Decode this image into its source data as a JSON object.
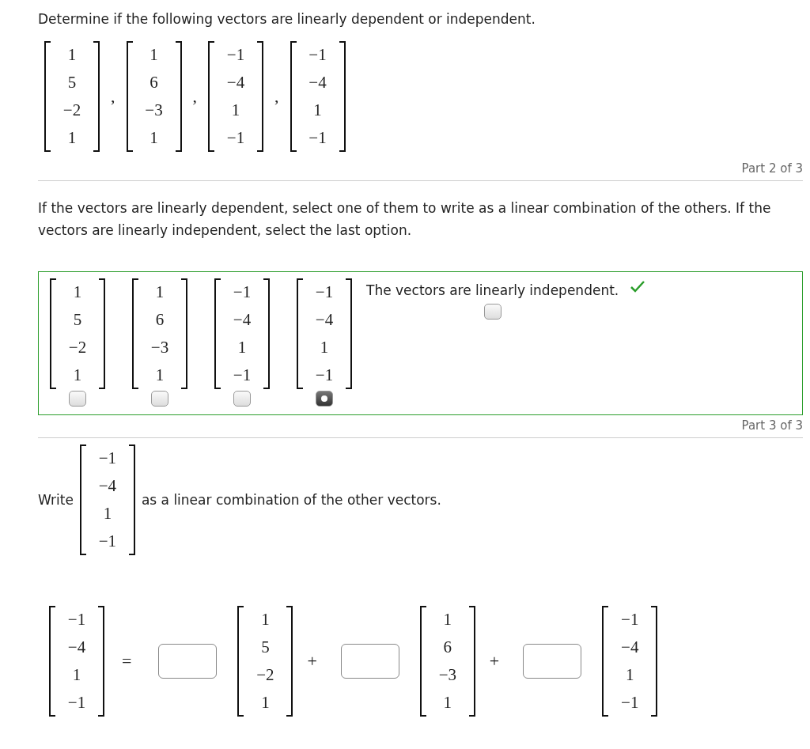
{
  "question": "Determine if the following vectors are linearly dependent or independent.",
  "vectors": [
    {
      "entries": [
        "1",
        "5",
        "−2",
        "1"
      ],
      "separator": ","
    },
    {
      "entries": [
        "1",
        "6",
        "−3",
        "1"
      ],
      "separator": ","
    },
    {
      "entries": [
        "−1",
        "−4",
        "1",
        "−1"
      ],
      "separator": ","
    },
    {
      "entries": [
        "−1",
        "−4",
        "1",
        "−1"
      ]
    }
  ],
  "part2": {
    "label": "Part 2 of 3",
    "prompt": "If the vectors are linearly dependent, select one of them to write as a linear combination of the others. If the vectors are linearly independent, select the last option.",
    "correct": true,
    "options": [
      {
        "kind": "vector",
        "entries": [
          "1",
          "5",
          "−2",
          "1"
        ],
        "selected": false
      },
      {
        "kind": "vector",
        "entries": [
          "1",
          "6",
          "−3",
          "1"
        ],
        "selected": false
      },
      {
        "kind": "vector",
        "entries": [
          "−1",
          "−4",
          "1",
          "−1"
        ],
        "selected": false
      },
      {
        "kind": "vector",
        "entries": [
          "−1",
          "−4",
          "1",
          "−1"
        ],
        "selected": true
      },
      {
        "kind": "text",
        "text": "The vectors are linearly independent.",
        "selected": false
      }
    ]
  },
  "part3": {
    "label": "Part 3 of 3",
    "write": "Write",
    "vector": [
      "−1",
      "−4",
      "1",
      "−1"
    ],
    "rest": "as a linear combination of the other vectors.",
    "equation": {
      "lhs": [
        "−1",
        "−4",
        "1",
        "−1"
      ],
      "equals": "=",
      "terms": [
        {
          "entries": [
            "1",
            "5",
            "−2",
            "1"
          ],
          "operator": "+"
        },
        {
          "entries": [
            "1",
            "6",
            "−3",
            "1"
          ],
          "operator": "+"
        },
        {
          "entries": [
            "−1",
            "−4",
            "1",
            "−1"
          ]
        }
      ]
    }
  }
}
